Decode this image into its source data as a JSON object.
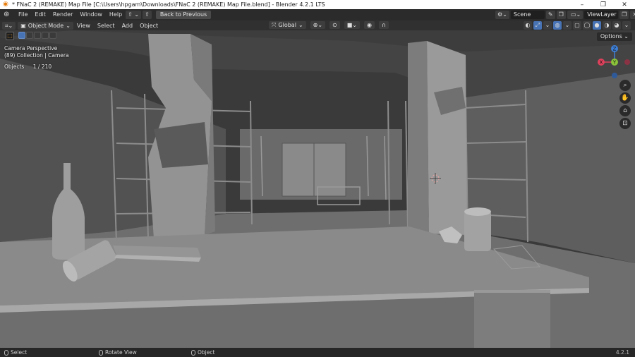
{
  "window": {
    "title": "* FNaC 2 (REMAKE) Map File [C:\\Users\\hpgam\\Downloads\\FNaC 2 (REMAKE) Map File.blend] - Blender 4.2.1 LTS",
    "minimize": "–",
    "maximize": "❐",
    "close": "✕"
  },
  "topbar": {
    "menus": [
      "File",
      "Edit",
      "Render",
      "Window",
      "Help"
    ],
    "back_label": "Back to Previous",
    "scene_label": "Scene",
    "viewlayer_label": "ViewLayer"
  },
  "viewport_header": {
    "mode": "Object Mode",
    "menus": [
      "View",
      "Select",
      "Add",
      "Object"
    ],
    "orientation": "Global",
    "options": "Options"
  },
  "overlay": {
    "perspective": "Camera Perspective",
    "collection": "(89) Collection | Camera",
    "objects_label": "Objects",
    "objects_count": "1 / 210"
  },
  "gizmo": {
    "x": "X",
    "y": "Y",
    "z": "Z",
    "x_color": "#e0415c",
    "y_color": "#8bc33a",
    "z_color": "#3e7fd6"
  },
  "status": {
    "select": "Select",
    "rotate": "Rotate View",
    "object": "Object",
    "version": "4.2.1"
  },
  "icons": {
    "blender": "blender-logo-icon",
    "search": "search-icon",
    "hand": "hand-icon",
    "camera": "camera-icon",
    "lock": "lock-icon"
  }
}
